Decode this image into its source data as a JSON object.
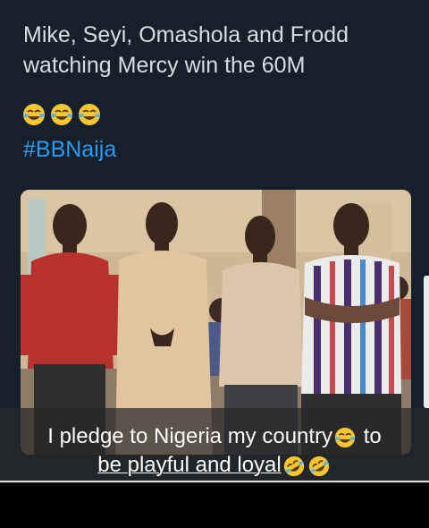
{
  "post": {
    "line1": "Mike, Seyi, Omashola and Frodd",
    "line2": "watching Mercy win the 60M",
    "emojis": [
      "face-with-tears-of-joy-icon",
      "face-with-tears-of-joy-icon",
      "face-with-tears-of-joy-icon"
    ],
    "hashtag": "#BBNaija",
    "colors": {
      "background": "#16202b",
      "text": "#d9dde2",
      "hashtag": "#2b9af3"
    }
  },
  "photo": {
    "description_icon": "photo-of-four-men-standing"
  },
  "caption": {
    "line1_prefix": "I pledge to Nigeria my country",
    "line1_suffix": " to",
    "line2": "be playful and loyal",
    "line1_emoji": "face-with-tears-of-joy-icon",
    "line2_emojis": [
      "rolling-on-floor-laughing-icon",
      "rolling-on-floor-laughing-icon"
    ]
  }
}
